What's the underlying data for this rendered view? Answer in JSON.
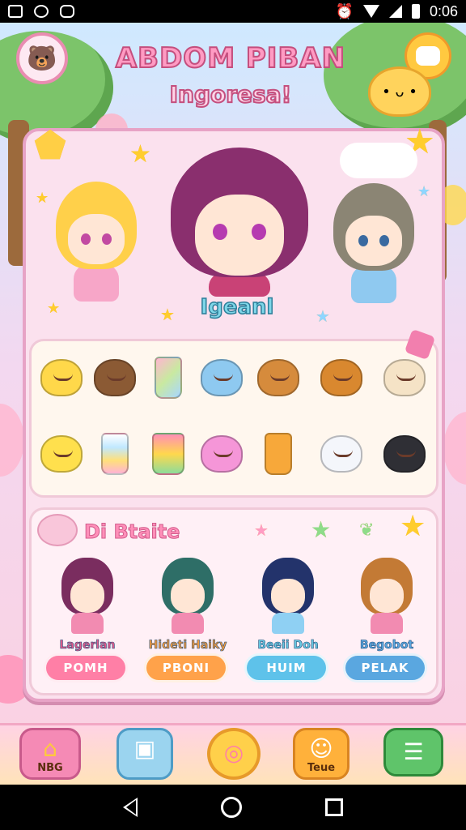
{
  "status_bar": {
    "time": "0:06"
  },
  "header": {
    "title": "ABDOM PIBAN",
    "subtitle": "Ingoresa!"
  },
  "featured": {
    "label": "Igeanl"
  },
  "section": {
    "title": "Di Btaite"
  },
  "cards": [
    {
      "name": "Lagerlan",
      "button": "POMH",
      "name_color": "#e05a8a",
      "button_color": "#ff7fa6"
    },
    {
      "name": "Hideti Haiky",
      "button": "PBONI",
      "name_color": "#f29b3f",
      "button_color": "#ffa24a"
    },
    {
      "name": "Beeii Doh",
      "button": "HUIM",
      "name_color": "#67c7e0",
      "button_color": "#5ec2ea"
    },
    {
      "name": "Begobot",
      "button": "PELAK",
      "name_color": "#5aa7e0",
      "button_color": "#5aa7e0"
    }
  ],
  "bottom_nav": [
    {
      "label": "NBG",
      "icon": "home-icon"
    },
    {
      "label": "",
      "icon": "inventory-icon"
    },
    {
      "label": "",
      "icon": "ring-icon"
    },
    {
      "label": "Teue",
      "icon": "mascot-icon"
    },
    {
      "label": "",
      "icon": "menu-icon"
    }
  ]
}
